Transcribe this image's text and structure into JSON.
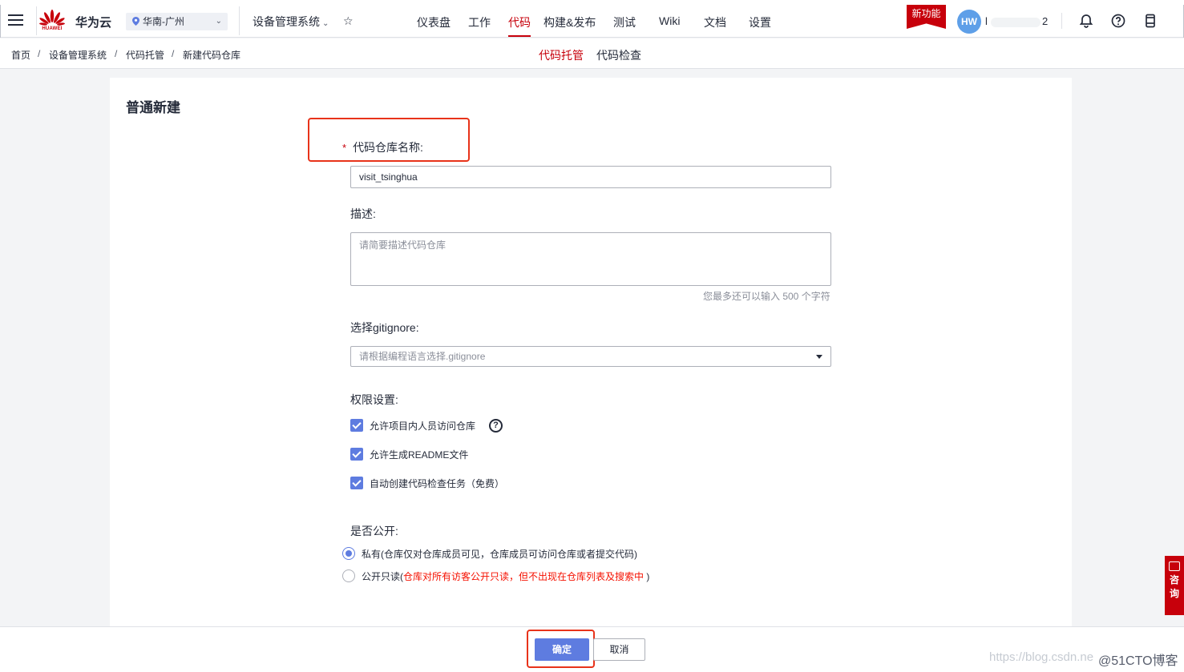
{
  "topbar": {
    "brand_text": "HUAWEI",
    "cloud_name": "华为云",
    "region": "华南-广州",
    "project": "设备管理系统",
    "nav": [
      "仪表盘",
      "工作",
      "代码",
      "构建&发布",
      "测试",
      "Wiki",
      "文档",
      "设置"
    ],
    "active_nav": "代码",
    "new_feature": "新功能",
    "avatar_initials": "HW",
    "user_name_start": "l",
    "user_name_end": "2"
  },
  "breadcrumb": [
    "首页",
    "设备管理系统",
    "代码托管",
    "新建代码仓库"
  ],
  "breadcrumb_separator": "/",
  "subtabs": [
    "代码托管",
    "代码检查"
  ],
  "active_subtab": "代码托管",
  "form": {
    "title": "普通新建",
    "required_mark": "*",
    "repo_name_label": "代码仓库名称:",
    "repo_name_value": "visit_tsinghua",
    "desc_label": "描述:",
    "desc_placeholder": "请简要描述代码仓库",
    "desc_hint": "您最多还可以输入 500 个字符",
    "gitignore_label": "选择gitignore:",
    "gitignore_placeholder": "请根据编程语言选择.gitignore",
    "perm_label": "权限设置:",
    "permissions": [
      {
        "label": "允许项目内人员访问仓库",
        "checked": true
      },
      {
        "label": "允许生成README文件",
        "checked": true
      },
      {
        "label": "自动创建代码检查任务（免费）",
        "checked": true
      }
    ],
    "public_label": "是否公开:",
    "private_option": "私有(仓库仅对仓库成员可见，仓库成员可访问仓库或者提交代码)",
    "public_option_prefix": "公开只读(",
    "public_option_red": "仓库对所有访客公开只读，但不出现在仓库列表及搜索中",
    "public_option_suffix": " )",
    "selected_visibility": "private"
  },
  "footer": {
    "ok": "确定",
    "cancel": "取消",
    "watermark_url": "https://blog.csdn.ne",
    "watermark_site": "@51CTO博客"
  },
  "consult": {
    "char1": "咨",
    "char2": "询"
  },
  "colors": {
    "brand_red": "#c7000b",
    "primary_blue": "#5e7ce0",
    "annotation_red": "#e8331a"
  }
}
